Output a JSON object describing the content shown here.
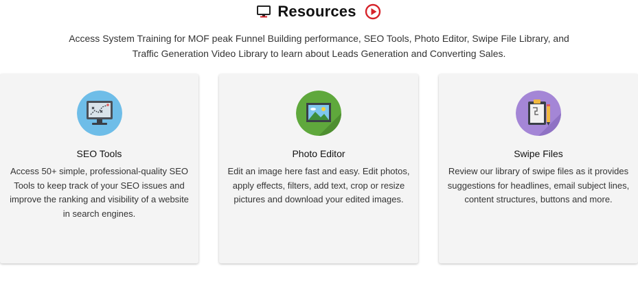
{
  "header": {
    "title": "Resources",
    "intro": "Access System Training for MOF peak Funnel Building performance, SEO Tools, Photo Editor, Swipe File Library, and Traffic Generation Video Library to learn about Leads Generation and Converting Sales.",
    "icons": [
      "monitor-icon",
      "play-circle-icon"
    ]
  },
  "cards": [
    {
      "title": "SEO Tools",
      "description": "Access 50+ simple, professional-quality SEO Tools to keep track of your SEO issues and improve the ranking and visibility of a website in search engines.",
      "icon": "seo-monitor-icon",
      "icon_bg": "#6ebde8"
    },
    {
      "title": "Photo Editor",
      "description": "Edit an image here fast and easy. Edit photos, apply effects, filters, add text, crop or resize pictures and download your edited images.",
      "icon": "photo-frame-icon",
      "icon_bg": "#5fa83c"
    },
    {
      "title": "Swipe Files",
      "description": "Review our library of swipe files as it provides suggestions for headlines, email subject lines, content structures, buttons and more.",
      "icon": "clipboard-pencil-icon",
      "icon_bg": "#a486d6"
    }
  ],
  "colors": {
    "accent_red": "#d6232a",
    "card_bg": "#f4f4f4",
    "text": "#333333"
  }
}
